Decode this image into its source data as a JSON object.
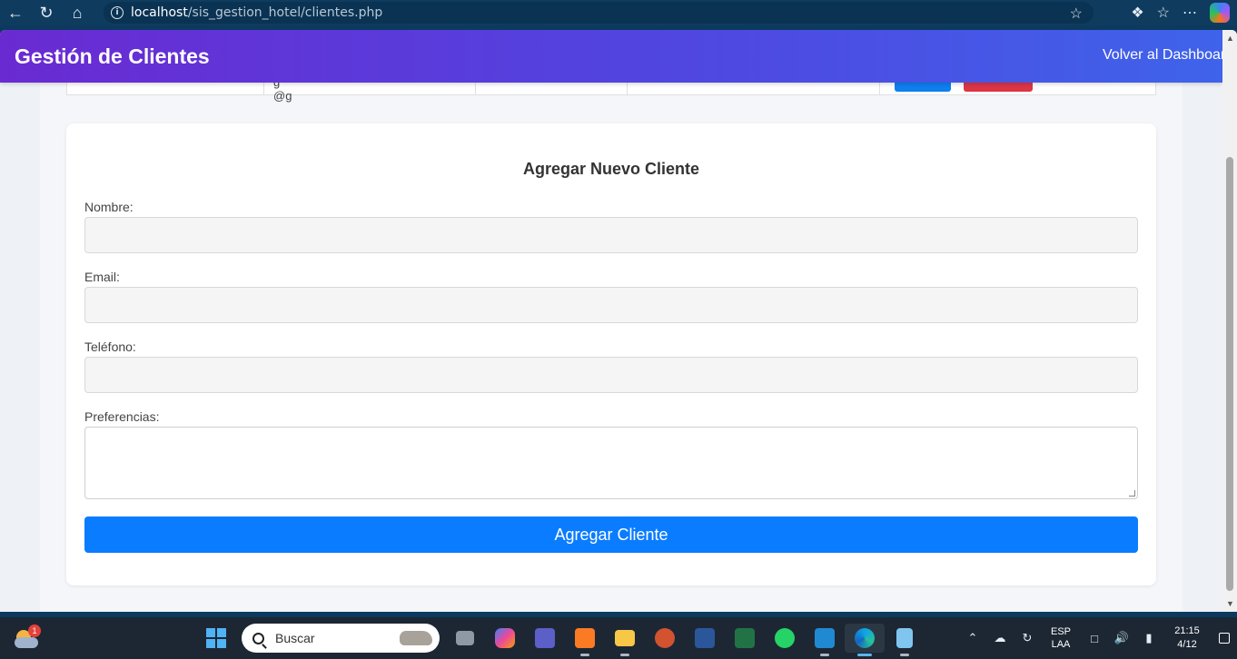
{
  "browser": {
    "host": "localhost",
    "path": "/sis_gestion_hotel/clientes.php"
  },
  "header": {
    "title": "Gestión de Clientes",
    "back_link": "Volver al Dashboard"
  },
  "table_fragment": {
    "email_fragment": "g  @g"
  },
  "form": {
    "title": "Agregar Nuevo Cliente",
    "nombre_label": "Nombre:",
    "nombre_value": "",
    "email_label": "Email:",
    "email_value": "",
    "telefono_label": "Teléfono:",
    "telefono_value": "",
    "preferencias_label": "Preferencias:",
    "preferencias_value": "",
    "submit_label": "Agregar Cliente"
  },
  "taskbar": {
    "search_placeholder": "Buscar",
    "weather_badge": "1",
    "lang_line1": "ESP",
    "lang_line2": "LAA",
    "time": "21:15",
    "date": "4/12"
  },
  "colors": {
    "header_gradient_start": "#6a2ad2",
    "header_gradient_end": "#3f63ea",
    "primary_button": "#0a7cff",
    "danger_button": "#dc3545"
  }
}
